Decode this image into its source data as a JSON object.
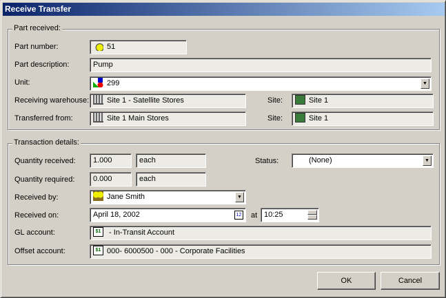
{
  "window": {
    "title": "Receive Transfer"
  },
  "part": {
    "group_label": "Part received:",
    "part_number_label": "Part number:",
    "part_number": "51",
    "description_label": "Part description:",
    "description": "Pump",
    "unit_label": "Unit:",
    "unit": "299",
    "receiving_label": "Receiving warehouse:",
    "receiving": "Site 1 - Satellite Stores",
    "site_label": "Site:",
    "receiving_site": "Site 1",
    "from_label": "Transferred from:",
    "from": "Site 1 Main Stores",
    "from_site": "Site 1"
  },
  "transaction": {
    "group_label": "Transaction details:",
    "qty_received_label": "Quantity received:",
    "qty_received": "1.000",
    "qty_received_unit": "each",
    "status_label": "Status:",
    "status": "(None)",
    "qty_required_label": "Quantity required:",
    "qty_required": "0.000",
    "qty_required_unit": "each",
    "received_by_label": "Received by:",
    "received_by": "Jane Smith",
    "received_on_label": "Received on:",
    "received_on": "April 18, 2002",
    "at_label": "at",
    "time": "10:25",
    "gl_label": "GL account:",
    "gl": " - In-Transit Account",
    "offset_label": "Offset account:",
    "offset": "000- 6000500 - 000 - Corporate Facilities"
  },
  "buttons": {
    "ok": "OK",
    "cancel": "Cancel"
  }
}
